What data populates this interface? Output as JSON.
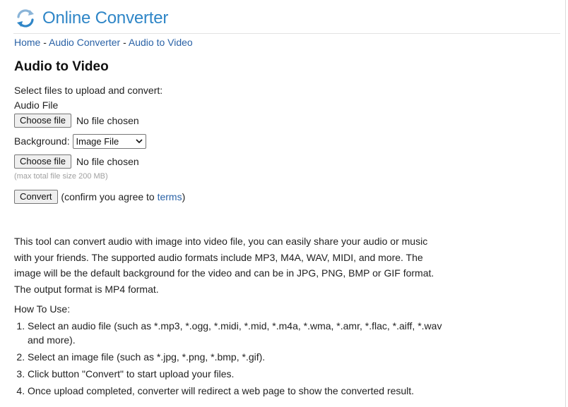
{
  "site": {
    "name": "Online Converter",
    "logo_icon": "refresh-arrows-icon",
    "brand_color": "#2f86c7",
    "link_color": "#2a62a6"
  },
  "breadcrumb": {
    "items": [
      "Home",
      "Audio Converter",
      "Audio to Video"
    ],
    "separator": " - "
  },
  "page": {
    "title": "Audio to Video"
  },
  "form": {
    "intro": "Select files to upload and convert:",
    "audio_label": "Audio File",
    "choose_file_label": "Choose file",
    "no_file_text": "No file chosen",
    "background_label": "Background:",
    "background_selected": "Image File",
    "max_size_note": "(max total file size 200 MB)",
    "convert_label": "Convert",
    "confirm_prefix": "(confirm you agree to ",
    "terms_label": "terms",
    "confirm_suffix": ")"
  },
  "description": "This tool can convert audio with image into video file, you can easily share your audio or music with your friends. The supported audio formats include MP3, M4A, WAV, MIDI, and more. The image will be the default background for the video and can be in JPG, PNG, BMP or GIF format. The output format is MP4 format.",
  "howto": {
    "title": "How To Use:",
    "steps": [
      "Select an audio file (such as *.mp3, *.ogg, *.midi, *.mid, *.m4a, *.wma, *.amr, *.flac, *.aiff, *.wav and more).",
      "Select an image file (such as *.jpg, *.png, *.bmp, *.gif).",
      "Click button \"Convert\" to start upload your files.",
      "Once upload completed, converter will redirect a web page to show the converted result."
    ]
  }
}
